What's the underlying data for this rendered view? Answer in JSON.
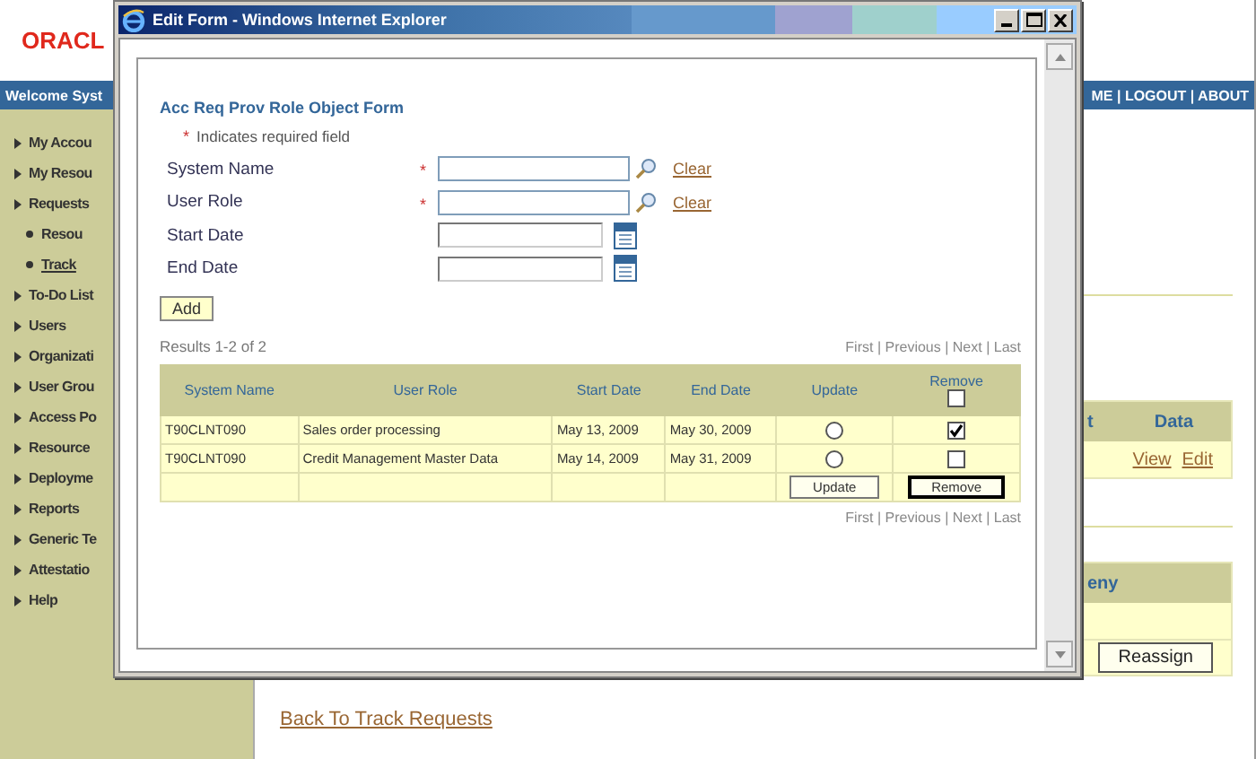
{
  "page": {
    "logo": "ORACL",
    "welcome": "Welcome Syst",
    "top_links": "ME | LOGOUT | ABOUT",
    "sidebar": [
      {
        "label": "My Accou",
        "kind": "section",
        "selected": false
      },
      {
        "label": "My Resou",
        "kind": "section",
        "selected": false
      },
      {
        "label": "Requests",
        "kind": "section",
        "selected": false
      },
      {
        "label": "Resou",
        "kind": "sub",
        "selected": false
      },
      {
        "label": "Track",
        "kind": "sub",
        "selected": true
      },
      {
        "label": "To-Do List",
        "kind": "section",
        "selected": false
      },
      {
        "label": "Users",
        "kind": "section",
        "selected": false
      },
      {
        "label": "Organizati",
        "kind": "section",
        "selected": false
      },
      {
        "label": "User Grou",
        "kind": "section",
        "selected": false
      },
      {
        "label": "Access Po",
        "kind": "section",
        "selected": false
      },
      {
        "label": "Resource",
        "kind": "section",
        "selected": false
      },
      {
        "label": "Deployme",
        "kind": "section",
        "selected": false
      },
      {
        "label": "Reports",
        "kind": "section",
        "selected": false
      },
      {
        "label": "Generic Te",
        "kind": "section",
        "selected": false
      },
      {
        "label": "Attestatio",
        "kind": "section",
        "selected": false
      },
      {
        "label": "Help",
        "kind": "section",
        "selected": false
      }
    ],
    "panel_1": {
      "columns": [
        "t",
        "Data"
      ],
      "links": [
        "View",
        "Edit"
      ]
    },
    "panel_2": {
      "header": "eny",
      "button": "Reassign"
    },
    "back_link": "Back To Track Requests"
  },
  "browser_window": {
    "title": "Edit Form - Windows Internet Explorer",
    "form": {
      "title": "Acc Req Prov Role Object Form",
      "required_mark": "*",
      "required_note": "Indicates required field",
      "fields": [
        {
          "label": "System Name",
          "required": true,
          "kind": "lookup",
          "action": "Clear"
        },
        {
          "label": "User Role",
          "required": true,
          "kind": "lookup",
          "action": "Clear"
        },
        {
          "label": "Start Date",
          "required": false,
          "kind": "date"
        },
        {
          "label": "End Date",
          "required": false,
          "kind": "date"
        }
      ],
      "add_button": "Add",
      "results": "Results 1-2 of 2",
      "pager_top": "First | Previous | Next | Last",
      "table": {
        "columns": [
          "System Name",
          "User Role",
          "Start Date",
          "End Date",
          "Update",
          "Remove"
        ],
        "remove_all_checked": false,
        "rows": [
          {
            "cells": [
              "T90CLNT090",
              "Sales order processing",
              "May 13, 2009",
              "May 30, 2009"
            ],
            "update_selected": false,
            "remove_checked": true
          },
          {
            "cells": [
              "T90CLNT090",
              "Credit Management Master Data",
              "May 14, 2009",
              "May 31, 2009"
            ],
            "update_selected": false,
            "remove_checked": false
          }
        ],
        "footer_buttons": [
          "Update",
          "Remove"
        ]
      },
      "pager_bottom": "First | Previous | Next | Last"
    }
  }
}
